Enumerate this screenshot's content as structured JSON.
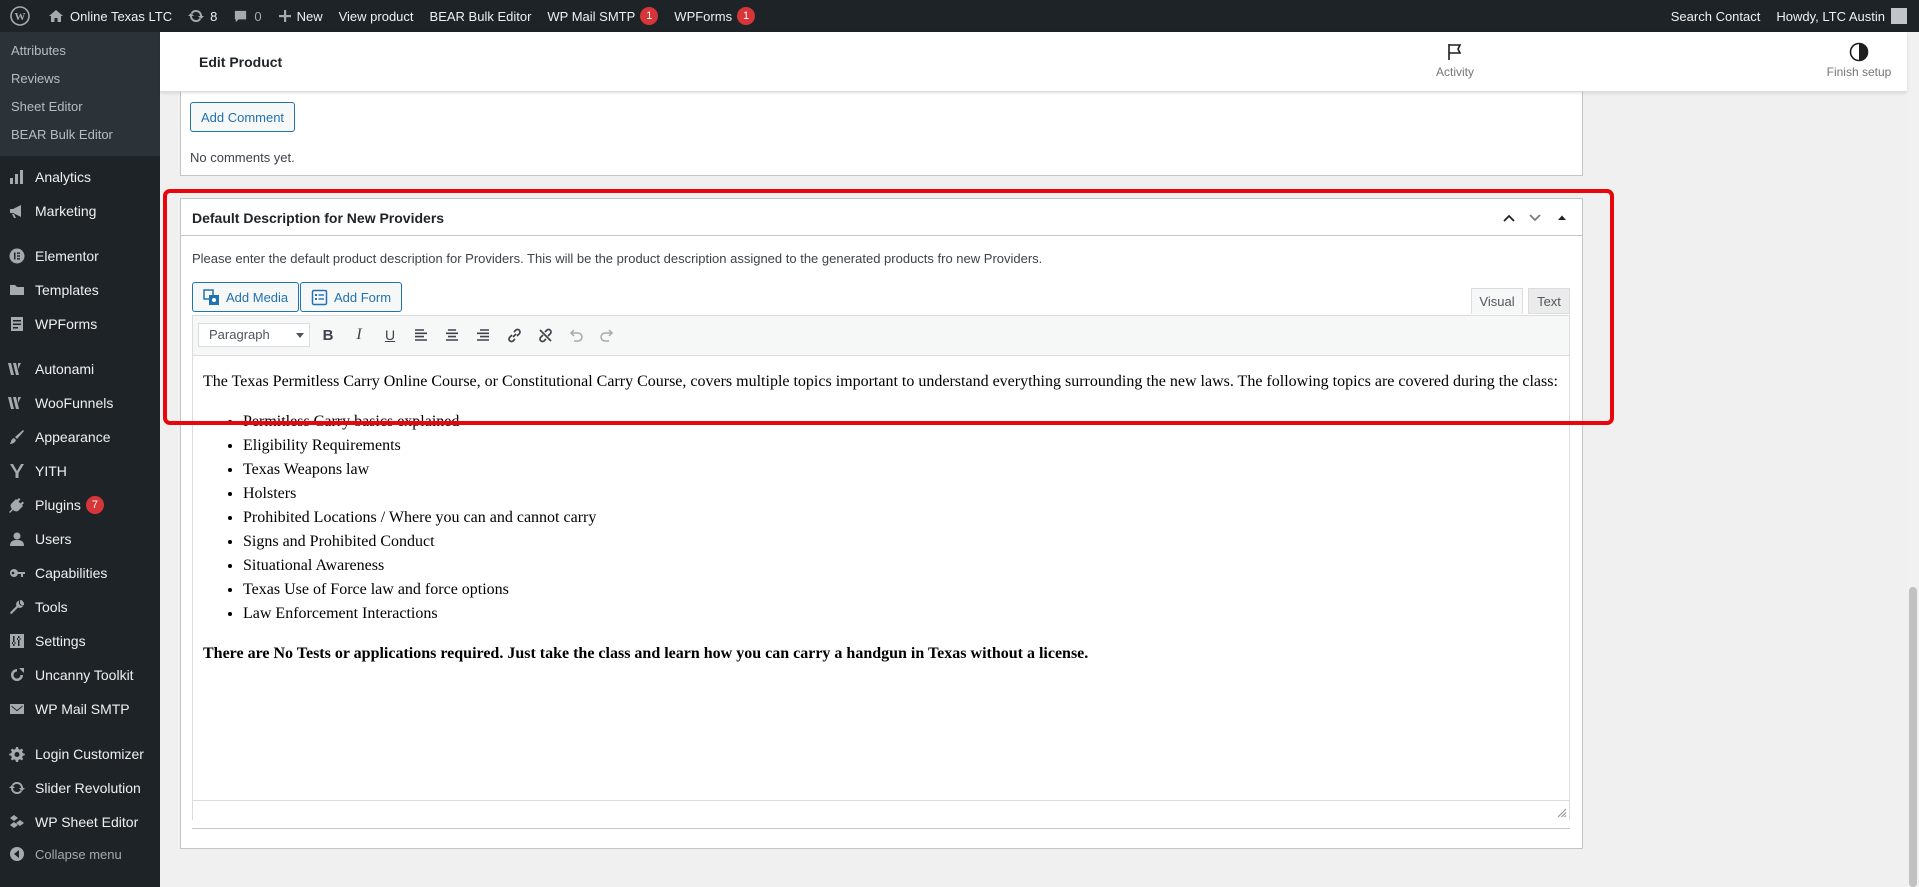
{
  "adminbar": {
    "site_name": "Online Texas LTC",
    "updates_count": "8",
    "comments_count": "0",
    "new_label": "New",
    "view_product": "View product",
    "bear_bulk_editor": "BEAR Bulk Editor",
    "wp_mail_smtp": "WP Mail SMTP",
    "wp_mail_smtp_badge": "1",
    "wpforms": "WPForms",
    "wpforms_badge": "1",
    "search_contact": "Search Contact",
    "howdy": "Howdy, LTC Austin"
  },
  "sidebar": {
    "submenu": [
      "Attributes",
      "Reviews",
      "Sheet Editor",
      "BEAR Bulk Editor"
    ],
    "analytics": "Analytics",
    "marketing": "Marketing",
    "elementor": "Elementor",
    "templates": "Templates",
    "wpforms": "WPForms",
    "autonami": "Autonami",
    "woofunnels": "WooFunnels",
    "appearance": "Appearance",
    "yith": "YITH",
    "plugins": "Plugins",
    "plugins_badge": "7",
    "users": "Users",
    "capabilities": "Capabilities",
    "tools": "Tools",
    "settings": "Settings",
    "uncanny_toolkit": "Uncanny Toolkit",
    "wp_mail_smtp": "WP Mail SMTP",
    "login_customizer": "Login Customizer",
    "slider_revolution": "Slider Revolution",
    "wp_sheet_editor": "WP Sheet Editor",
    "collapse_menu": "Collapse menu"
  },
  "header": {
    "title": "Edit Product",
    "activity": "Activity",
    "finish_setup": "Finish setup"
  },
  "comments": {
    "add_comment": "Add Comment",
    "no_comments": "No comments yet."
  },
  "description_box": {
    "title": "Default Description for New Providers",
    "help_text": "Please enter the default product description for Providers. This will be the product description assigned to the generated products fro new Providers.",
    "add_media": "Add Media",
    "add_form": "Add Form",
    "tab_visual": "Visual",
    "tab_text": "Text",
    "format_value": "Paragraph"
  },
  "content": {
    "intro": "The Texas Permitless Carry Online Course, or Constitutional Carry Course, covers multiple topics important to understand everything surrounding the new laws.  The following topics are covered during the class:",
    "topics": [
      "Permitless Carry basics explained",
      "Eligibility Requirements",
      "Texas Weapons law",
      "Holsters",
      "Prohibited Locations / Where you can and cannot carry",
      "Signs and Prohibited Conduct",
      "Situational Awareness",
      "Texas Use of Force law and force options",
      "Law Enforcement Interactions"
    ],
    "closing": "There are No Tests or applications required. Just take the class and learn how you can carry a handgun in Texas without a license."
  },
  "colors": {
    "admin_dark": "#1d2327",
    "accent_blue": "#2271b1",
    "badge_red": "#d63638",
    "highlight_red": "#e8060c"
  }
}
